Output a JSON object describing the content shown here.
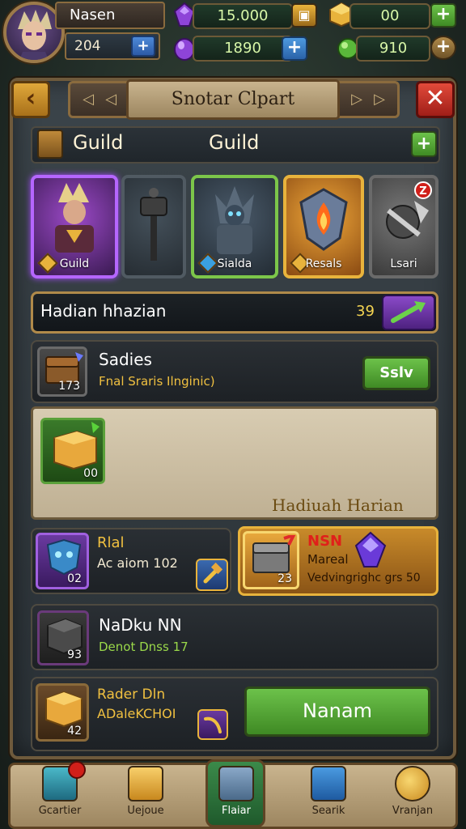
{
  "player": {
    "name": "Nasen",
    "level": "204",
    "avatar_icon": "hero-portrait-icon"
  },
  "resources": [
    {
      "icon": "purple-gem-icon",
      "value": "15.000",
      "button_icon": "shop-chest-icon"
    },
    {
      "icon": "gold-block-icon",
      "value": "00",
      "button_icon": "plus-icon"
    },
    {
      "icon": "purple-crystal-icon",
      "value": "1890",
      "button_icon": "plus-icon"
    },
    {
      "icon": "green-orb-icon",
      "value": "910",
      "button_icon": "plus-icon"
    }
  ],
  "header": {
    "title": "Snotar Clpart",
    "back_icon": "chevron-left-icon",
    "close_icon": "close-icon"
  },
  "guild": {
    "label_left": "Guild",
    "label_center": "Guild",
    "add_icon": "plus-icon"
  },
  "heroes": [
    {
      "label": "Guild",
      "frame": "purple"
    },
    {
      "label": "",
      "frame": "dark"
    },
    {
      "label": "Sialda",
      "frame": "green"
    },
    {
      "label": "Resals",
      "frame": "gold"
    },
    {
      "label": "Lsari",
      "frame": "grey",
      "badge": "Z"
    }
  ],
  "quest": {
    "title": "Hadian hhazian",
    "count": "39"
  },
  "row1": {
    "title": "Sadies",
    "subtitle": "Fnal Sraris Ilnginic)",
    "count": "173",
    "button": "Sslv"
  },
  "reward": {
    "count": "00",
    "label": "Hadiuah Harian"
  },
  "row2a": {
    "title": "Rlal",
    "subtitle": "Ac aiom 102",
    "count": "02"
  },
  "row2b": {
    "title": "NSN",
    "subtitle_1": "Mareal",
    "subtitle_2": "Vedvingrighc grs 50",
    "count": "23"
  },
  "row3": {
    "title": "NaDku NN",
    "subtitle": "Denot Dnss 17",
    "count": "93"
  },
  "row4": {
    "title": "Rader Dln",
    "subtitle": "ADaleKCHOI",
    "count": "42",
    "button": "Nanam"
  },
  "nav": [
    {
      "label": "Gcartier",
      "icon": "crystal-icon"
    },
    {
      "label": "Uejoue",
      "icon": "gold-cube-icon"
    },
    {
      "label": "Flaiar",
      "icon": "box-icon"
    },
    {
      "label": "Searik",
      "icon": "potion-icon"
    },
    {
      "label": "Vranjan",
      "icon": "coin-icon"
    }
  ]
}
